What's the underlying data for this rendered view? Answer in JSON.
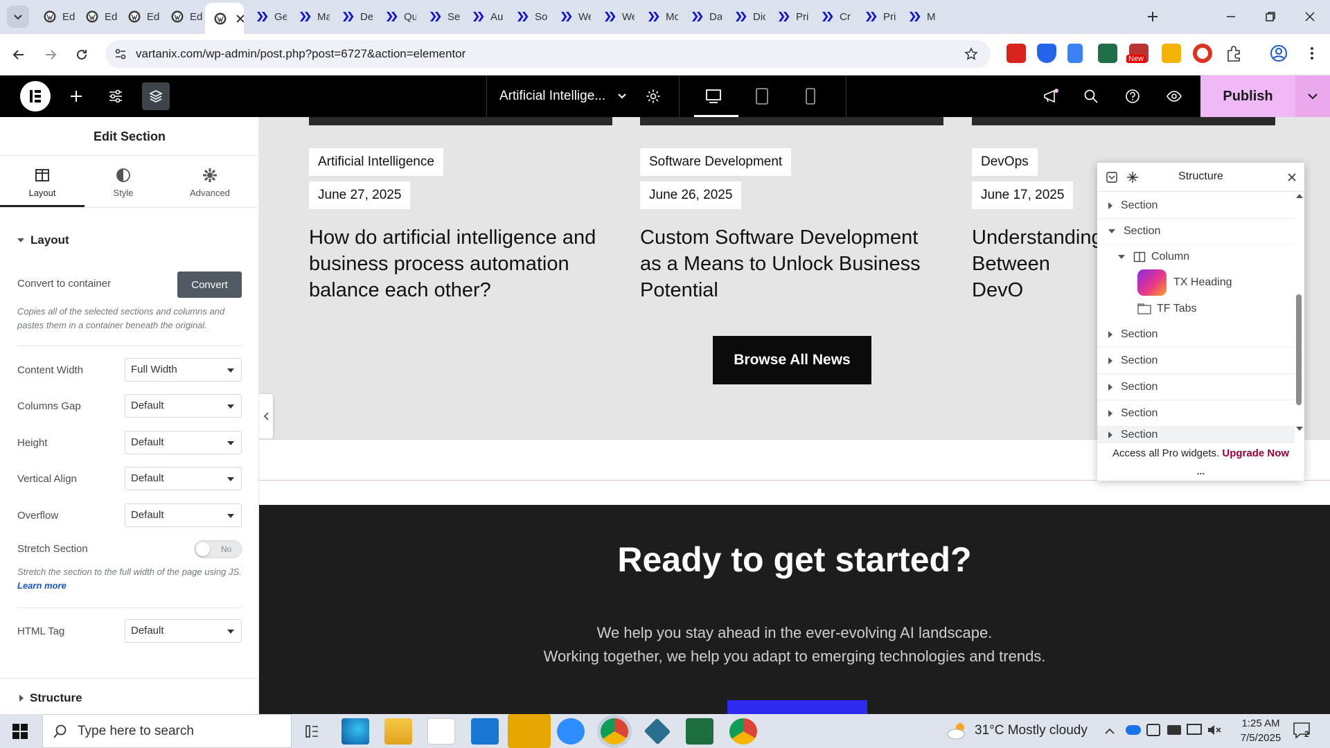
{
  "browser": {
    "tabs": [
      {
        "label": "Ed",
        "icon": "wordpress-icon"
      },
      {
        "label": "Ed",
        "icon": "wordpress-icon"
      },
      {
        "label": "Ed",
        "icon": "wordpress-icon"
      },
      {
        "label": "Ed",
        "icon": "wordpress-icon"
      },
      {
        "label": "",
        "icon": "wordpress-icon",
        "active": true
      },
      {
        "label": "Ge",
        "icon": "x-logo-icon"
      },
      {
        "label": "Ma",
        "icon": "x-logo-icon"
      },
      {
        "label": "De",
        "icon": "x-logo-icon"
      },
      {
        "label": "Qu",
        "icon": "x-logo-icon"
      },
      {
        "label": "Sel",
        "icon": "x-logo-icon"
      },
      {
        "label": "Au",
        "icon": "x-logo-icon"
      },
      {
        "label": "So",
        "icon": "x-logo-icon"
      },
      {
        "label": "We",
        "icon": "x-logo-icon"
      },
      {
        "label": "We",
        "icon": "x-logo-icon"
      },
      {
        "label": "Mc",
        "icon": "x-logo-icon"
      },
      {
        "label": "Da",
        "icon": "x-logo-icon"
      },
      {
        "label": "Dic",
        "icon": "x-logo-icon"
      },
      {
        "label": "Pri",
        "icon": "x-logo-icon"
      },
      {
        "label": "Cr",
        "icon": "x-logo-icon"
      },
      {
        "label": "Pri",
        "icon": "x-logo-icon"
      },
      {
        "label": "M",
        "icon": "x-logo-icon"
      }
    ],
    "url": "vartanix.com/wp-admin/post.php?post=6727&action=elementor",
    "extension_badge": "New"
  },
  "editor": {
    "page_title": "Artificial Intellige...",
    "publish_label": "Publish"
  },
  "panel": {
    "title": "Edit Section",
    "tabs": [
      "Layout",
      "Style",
      "Advanced"
    ],
    "section_heading": "Layout",
    "convert_label": "Convert to container",
    "convert_button": "Convert",
    "convert_help": "Copies all of the selected sections and columns and pastes them in a container beneath the original.",
    "controls": [
      {
        "label": "Content Width",
        "value": "Full Width"
      },
      {
        "label": "Columns Gap",
        "value": "Default"
      },
      {
        "label": "Height",
        "value": "Default"
      },
      {
        "label": "Vertical Align",
        "value": "Default"
      },
      {
        "label": "Overflow",
        "value": "Default"
      }
    ],
    "stretch_label": "Stretch Section",
    "stretch_value": "No",
    "stretch_help": "Stretch the section to the full width of the page using JS.",
    "learn_more": "Learn more",
    "html_tag_label": "HTML Tag",
    "html_tag_value": "Default",
    "structure_heading": "Structure"
  },
  "canvas": {
    "posts": [
      {
        "category": "Artificial Intelligence",
        "date": "June 27, 2025",
        "title": "How do artificial intelligence and business process automation balance each other?"
      },
      {
        "category": "Software Development",
        "date": "June 26, 2025",
        "title": "Custom Software Development as a Means to Unlock Business Potential"
      },
      {
        "category": "DevOps",
        "date": "June 17, 2025",
        "title": "Understanding Between DevO"
      }
    ],
    "browse_button": "Browse All News",
    "cta_heading": "Ready to get started?",
    "cta_line1": "We help you stay ahead in the ever-evolving AI landscape.",
    "cta_line2": "Working together, we help you adapt to emerging technologies and trends."
  },
  "navigator": {
    "title": "Structure",
    "rows": [
      {
        "label": "Section",
        "indent": 0,
        "arrow": "right"
      },
      {
        "label": "Section",
        "indent": 0,
        "arrow": "down"
      },
      {
        "label": "Column",
        "indent": 1,
        "arrow": "down"
      },
      {
        "label": "TX Heading",
        "indent": 2,
        "arrow": "none"
      },
      {
        "label": "TF Tabs",
        "indent": 2,
        "arrow": "none"
      },
      {
        "label": "Section",
        "indent": 0,
        "arrow": "right"
      },
      {
        "label": "Section",
        "indent": 0,
        "arrow": "right"
      },
      {
        "label": "Section",
        "indent": 0,
        "arrow": "right"
      },
      {
        "label": "Section",
        "indent": 0,
        "arrow": "right"
      },
      {
        "label": "Section",
        "indent": 0,
        "arrow": "right"
      }
    ],
    "pro_text": "Access all Pro widgets.",
    "upgrade_link": "Upgrade Now",
    "more": "..."
  },
  "taskbar": {
    "search_placeholder": "Type here to search",
    "weather": "31°C  Mostly cloudy",
    "time": "1:25 AM",
    "date": "7/5/2025",
    "notification_count": "2"
  },
  "colors": {
    "publish": "#f0b8f4",
    "elementor_accent": "#93003c",
    "cta_button": "#2f2af0"
  }
}
